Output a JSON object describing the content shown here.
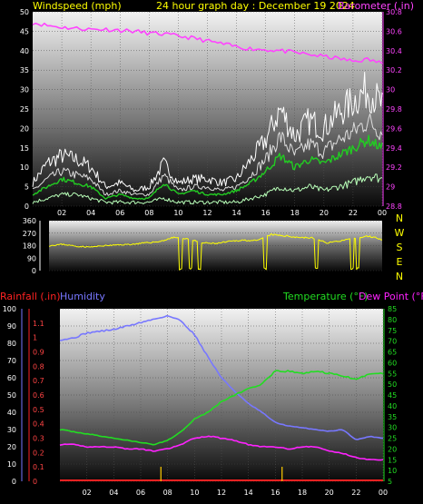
{
  "header": {
    "windspeed_label": "Windspeed (mph)",
    "title": "24 hour graph day : December 19 2024",
    "barometer_label": "Barometer (.in)"
  },
  "compass": [
    "N",
    "W",
    "S",
    "E",
    "N"
  ],
  "lower_header": {
    "rainfall_label": "Rainfall (.in)",
    "humidity_label": "Humidity",
    "temperature_label": "Temperature (°F)",
    "dewpoint_label": "Dew Point (°F)"
  },
  "colors": {
    "windspeed": "#ffffff",
    "gust": "#ffffff",
    "wind_avg": "#22cc22",
    "wind_low": "#b8ffb8",
    "barometer": "#ff44ff",
    "direction": "#ffff00",
    "temperature": "#22dd22",
    "dewpoint": "#ff22ff",
    "humidity": "#7777ff",
    "rainfall": "#ff2222",
    "rain_markers": "#ffcc00",
    "header_text": "#ffff00",
    "barometer_text": "#ff44ff"
  },
  "chart_data": [
    {
      "type": "line",
      "title": "24 hour graph day : December 19 2024",
      "x_tick_labels": [
        "02",
        "04",
        "06",
        "08",
        "10",
        "12",
        "14",
        "16",
        "18",
        "20",
        "22",
        "00"
      ],
      "x": [
        0,
        1,
        2,
        3,
        4,
        5,
        6,
        7,
        8,
        9,
        10,
        11,
        12,
        13,
        14,
        15,
        16,
        17,
        18,
        19,
        20,
        21,
        22,
        23,
        24
      ],
      "left_axis": {
        "label": "Windspeed (mph)",
        "ylim": [
          0,
          50
        ],
        "ticks": [
          "0",
          "5",
          "10",
          "15",
          "20",
          "25",
          "30",
          "35",
          "40",
          "45",
          "50"
        ]
      },
      "right_axis": {
        "label": "Barometer (.in)",
        "ylim": [
          28.8,
          30.8
        ],
        "ticks": [
          "28.8",
          "29",
          "29.2",
          "29.4",
          "29.6",
          "29.8",
          "30",
          "30.2",
          "30.4",
          "30.6",
          "30.8"
        ]
      },
      "series": [
        {
          "name": "Gust",
          "axis": "left",
          "values": [
            6,
            11,
            13,
            12,
            10,
            5,
            6,
            4,
            5,
            11,
            6,
            7,
            7,
            6,
            7,
            12,
            17,
            25,
            18,
            22,
            20,
            24,
            27,
            30,
            26
          ]
        },
        {
          "name": "Windspeed",
          "axis": "left",
          "values": [
            4,
            7,
            9,
            8,
            7,
            3,
            4,
            3,
            3,
            8,
            4,
            5,
            5,
            4,
            5,
            8,
            12,
            18,
            13,
            16,
            14,
            17,
            19,
            22,
            19
          ]
        },
        {
          "name": "Wind average",
          "axis": "left",
          "values": [
            3,
            5,
            7,
            6,
            5,
            2,
            3,
            2,
            2,
            6,
            3,
            4,
            3,
            3,
            4,
            6,
            9,
            13,
            10,
            12,
            11,
            13,
            15,
            17,
            15
          ]
        },
        {
          "name": "Wind low",
          "axis": "left",
          "values": [
            1,
            2,
            3,
            3,
            2,
            1,
            1,
            1,
            1,
            2,
            1,
            1,
            1,
            1,
            1,
            2,
            3,
            5,
            4,
            5,
            4,
            5,
            6,
            8,
            7
          ]
        },
        {
          "name": "Barometer",
          "axis": "right",
          "values": [
            30.69,
            30.66,
            30.64,
            30.63,
            30.62,
            30.62,
            30.61,
            30.6,
            30.58,
            30.57,
            30.55,
            30.53,
            30.5,
            30.47,
            30.44,
            30.42,
            30.41,
            30.4,
            30.38,
            30.36,
            30.34,
            30.32,
            30.29,
            30.31,
            30.27
          ]
        }
      ]
    },
    {
      "type": "line",
      "title": "",
      "x": [
        0,
        1,
        2,
        3,
        4,
        5,
        6,
        7,
        8,
        9,
        10,
        11,
        12,
        13,
        14,
        15,
        16,
        17,
        18,
        19,
        20,
        21,
        22,
        23,
        24
      ],
      "left_axis": {
        "ylim": [
          0,
          360
        ],
        "ticks": [
          "0",
          "90",
          "180",
          "270",
          "360"
        ]
      },
      "right_axis": {
        "ticks": [
          "N",
          "W",
          "S",
          "E",
          "N"
        ]
      },
      "series": [
        {
          "name": "Wind direction",
          "values": [
            180,
            190,
            175,
            170,
            180,
            185,
            190,
            200,
            210,
            240,
            230,
            200,
            195,
            210,
            220,
            215,
            260,
            250,
            240,
            235,
            200,
            215,
            230,
            250,
            225
          ]
        }
      ],
      "drops_to_zero_near_x": [
        9.5,
        10.2,
        10.8,
        15.6,
        19.3,
        21.8,
        22.2
      ]
    },
    {
      "type": "line",
      "title": "",
      "x_tick_labels": [
        "02",
        "04",
        "06",
        "08",
        "10",
        "12",
        "14",
        "16",
        "18",
        "20",
        "22",
        "00"
      ],
      "x": [
        0,
        1,
        2,
        3,
        4,
        5,
        6,
        7,
        8,
        9,
        10,
        11,
        12,
        13,
        14,
        15,
        16,
        17,
        18,
        19,
        20,
        21,
        22,
        23,
        24
      ],
      "axes": {
        "humidity": {
          "label": "Humidity",
          "ylim": [
            0,
            100
          ],
          "ticks": [
            "0",
            "10",
            "20",
            "30",
            "40",
            "50",
            "60",
            "70",
            "80",
            "90",
            "100"
          ]
        },
        "rainfall": {
          "label": "Rainfall (.in)",
          "ylim": [
            0,
            1.2
          ],
          "ticks": [
            "0",
            "0.1",
            "0.2",
            "0.3",
            "0.4",
            "0.5",
            "0.6",
            "0.7",
            "0.8",
            "0.9",
            "1",
            "1.1"
          ]
        },
        "temperature": {
          "label": "Temperature (°F) Dew Point (°F)",
          "ylim": [
            5,
            85
          ],
          "ticks": [
            "5",
            "10",
            "15",
            "20",
            "25",
            "30",
            "35",
            "40",
            "45",
            "50",
            "55",
            "60",
            "65",
            "70",
            "75",
            "80",
            "85"
          ]
        }
      },
      "series": [
        {
          "name": "Humidity",
          "axis": "humidity",
          "values": [
            82,
            83,
            86,
            87,
            88,
            90,
            92,
            94,
            96,
            93,
            85,
            72,
            60,
            52,
            45,
            40,
            34,
            32,
            31,
            30,
            29,
            30,
            24,
            26,
            25
          ]
        },
        {
          "name": "Temperature",
          "axis": "temperature",
          "values": [
            29,
            28,
            27,
            26,
            25,
            24,
            23,
            22,
            24,
            28,
            34,
            37,
            42,
            45,
            48,
            50,
            56,
            56,
            55,
            56,
            55,
            54,
            52,
            55,
            55
          ]
        },
        {
          "name": "Dew Point",
          "axis": "temperature",
          "values": [
            22,
            22,
            21,
            21,
            21,
            20,
            20,
            19,
            20,
            22,
            25,
            26,
            25,
            24,
            22,
            21,
            21,
            20,
            21,
            21,
            19,
            18,
            16,
            15,
            15
          ]
        },
        {
          "name": "Rainfall",
          "axis": "rainfall",
          "values": [
            0,
            0,
            0,
            0,
            0,
            0,
            0,
            0,
            0,
            0,
            0,
            0,
            0,
            0,
            0,
            0,
            0,
            0,
            0,
            0,
            0,
            0,
            0,
            0,
            0
          ]
        }
      ],
      "rain_markers_at_x": [
        7.5,
        16.5
      ]
    }
  ]
}
